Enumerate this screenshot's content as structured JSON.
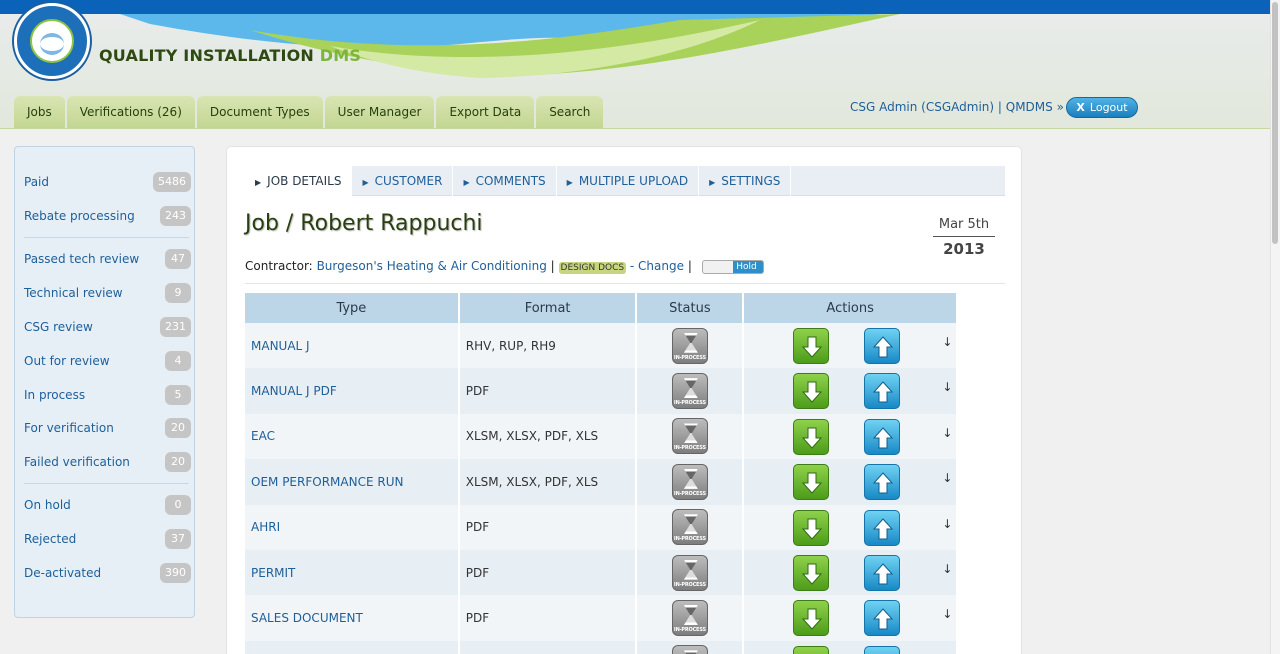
{
  "header": {
    "logo_text": "A-C QUALITY INSTALLATION",
    "app_title_main": "QUALITY INSTALLATION ",
    "app_title_accent": "DMS",
    "user_info": "CSG Admin (CSGAdmin) | QMDMS »",
    "logout_icon": "X",
    "logout_label": "Logout"
  },
  "nav": {
    "jobs": "Jobs",
    "verifications": "Verifications (26)",
    "document_types": "Document Types",
    "user_manager": "User Manager",
    "export_data": "Export Data",
    "search": "Search"
  },
  "sidebar": {
    "items": [
      {
        "label": "Paid",
        "count": "5486"
      },
      {
        "label": "Rebate processing",
        "count": "243"
      },
      {
        "label": "Passed tech review",
        "count": "47"
      },
      {
        "label": "Technical review",
        "count": "9"
      },
      {
        "label": "CSG review",
        "count": "231"
      },
      {
        "label": "Out for review",
        "count": "4"
      },
      {
        "label": "In process",
        "count": "5"
      },
      {
        "label": "For verification",
        "count": "20"
      },
      {
        "label": "Failed verification",
        "count": "20"
      },
      {
        "label": "On hold",
        "count": "0"
      },
      {
        "label": "Rejected",
        "count": "37"
      },
      {
        "label": "De-activated",
        "count": "390"
      }
    ]
  },
  "job_tabs": {
    "details": "JOB DETAILS",
    "customer": "CUSTOMER",
    "comments": "COMMENTS",
    "upload": "MULTIPLE UPLOAD",
    "settings": "SETTINGS"
  },
  "job": {
    "title": "Job / Robert Rappuchi",
    "date_md": "Mar 5th",
    "date_year": "2013",
    "contractor_label": "Contractor:",
    "contractor_name": "Burgeson's Heating & Air Conditioning",
    "sep1": "|",
    "design_badge": "DESIGN DOCS",
    "change_link": "- Change",
    "sep2": "|",
    "hold_label": "Hold"
  },
  "table": {
    "headers": {
      "type": "Type",
      "format": "Format",
      "status": "Status",
      "actions": "Actions"
    },
    "status_caption": "IN-PROCESS",
    "rows": [
      {
        "type": "MANUAL J",
        "format": "RHV, RUP, RH9"
      },
      {
        "type": "MANUAL J PDF",
        "format": "PDF"
      },
      {
        "type": "EAC",
        "format": "XLSM, XLSX, PDF, XLS"
      },
      {
        "type": "OEM PERFORMANCE RUN",
        "format": "XLSM, XLSX, PDF, XLS"
      },
      {
        "type": "AHRI",
        "format": "PDF"
      },
      {
        "type": "PERMIT",
        "format": "PDF"
      },
      {
        "type": "SALES DOCUMENT",
        "format": "PDF"
      },
      {
        "type": "",
        "format": ""
      }
    ],
    "small_arrow": "↓"
  },
  "icons": {
    "status": "hourglass-icon",
    "download": "download-arrow-icon",
    "upload": "upload-arrow-icon"
  },
  "colors": {
    "brand_blue": "#0a63b8",
    "brand_green": "#7db53a",
    "link_blue": "#1f5f99"
  }
}
